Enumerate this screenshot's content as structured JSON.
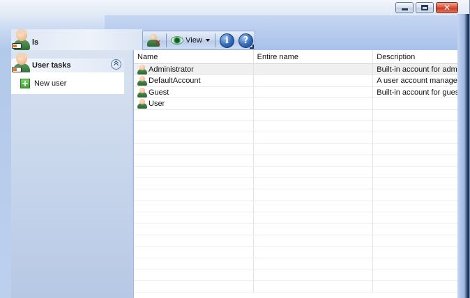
{
  "window": {
    "title": "ls",
    "caption": {
      "minimize": "minimize",
      "maximize": "maximize",
      "close": "✕"
    }
  },
  "toolbar": {
    "view_label": "View",
    "info_label": "i",
    "help_label": "?"
  },
  "tasks": {
    "header": "User tasks",
    "items": [
      {
        "label": "New user"
      }
    ]
  },
  "list": {
    "columns": [
      "Name",
      "Entire name",
      "Description"
    ],
    "rows": [
      {
        "name": "Administrator",
        "entire_name": "",
        "description": "Built-in account for admi"
      },
      {
        "name": "DefaultAccount",
        "entire_name": "",
        "description": "A user account managed"
      },
      {
        "name": "Guest",
        "entire_name": "",
        "description": "Built-in account for gues"
      },
      {
        "name": "User",
        "entire_name": "",
        "description": ""
      }
    ]
  }
}
